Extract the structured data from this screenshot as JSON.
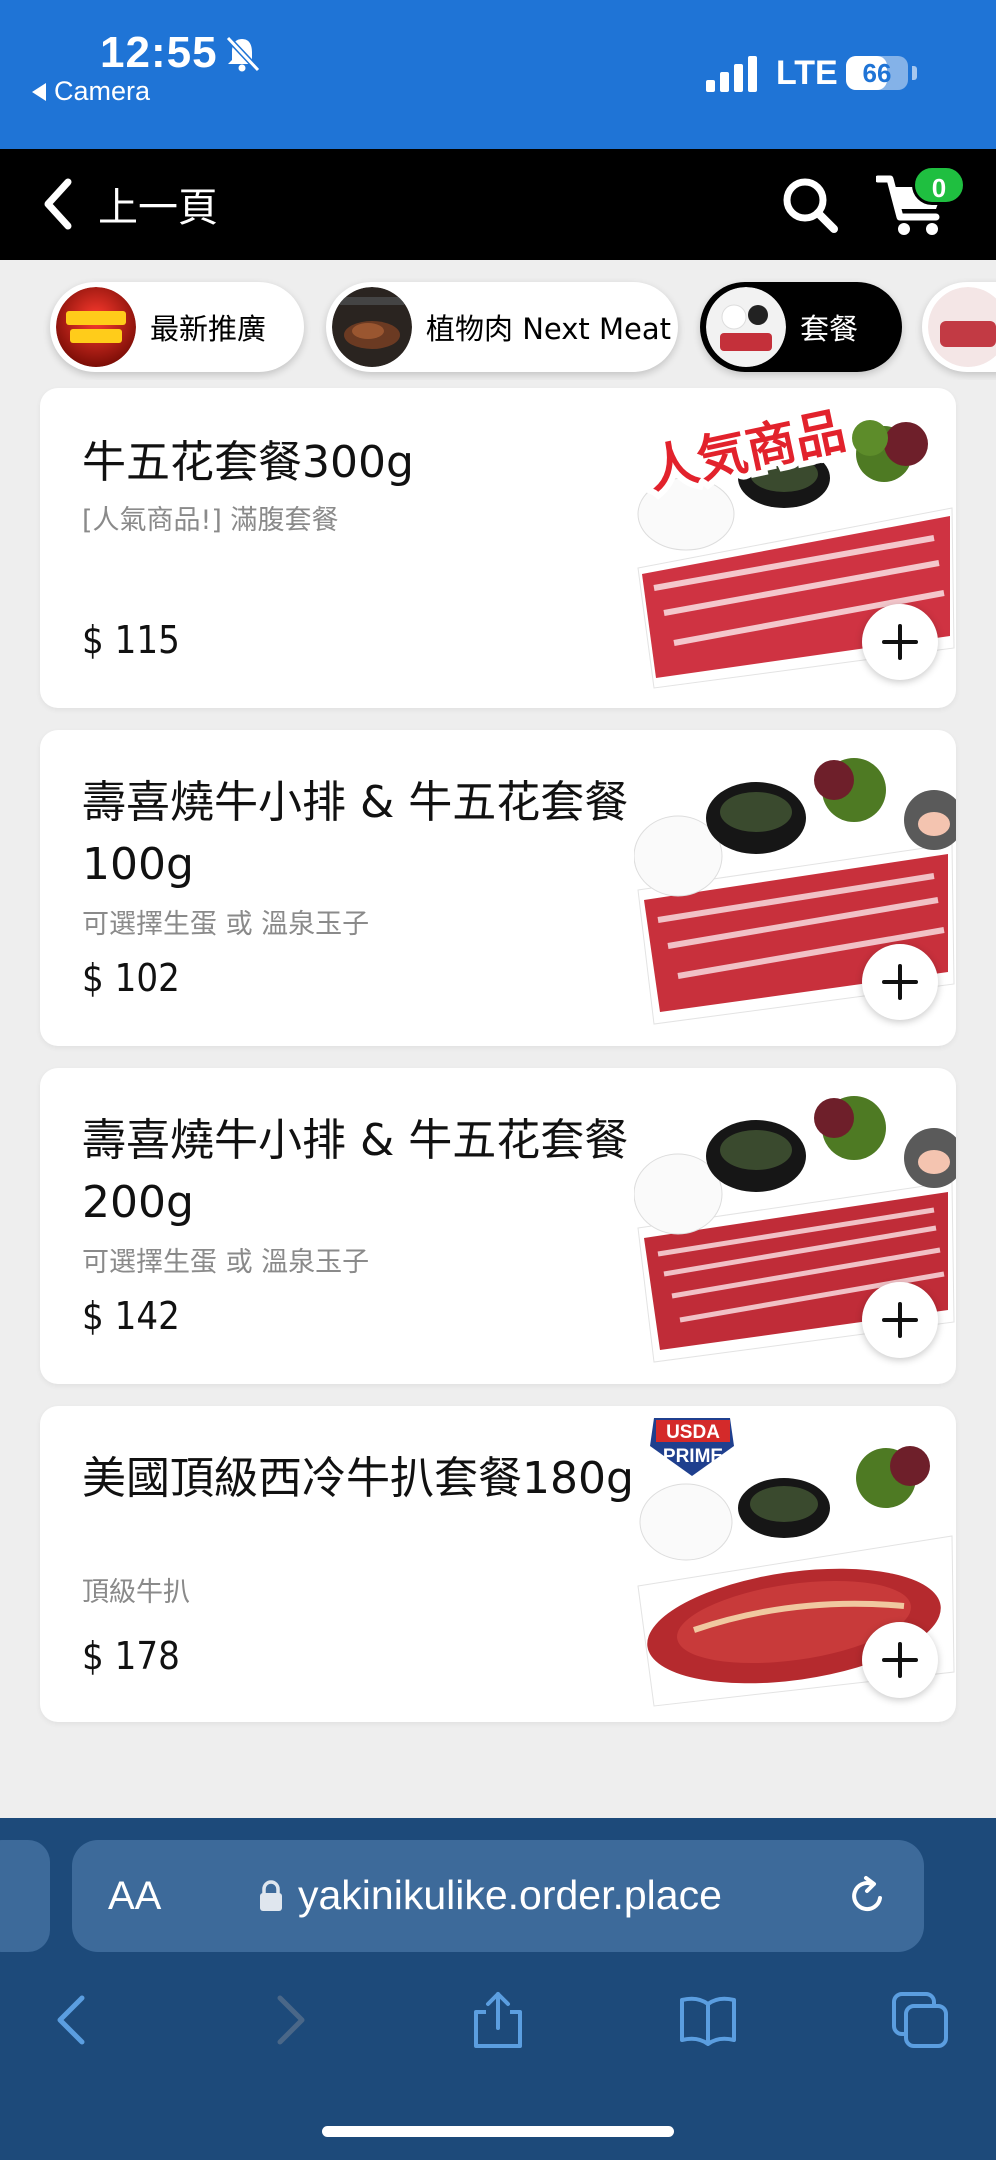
{
  "status_bar": {
    "time": "12:55",
    "back_app": "Camera",
    "network": "LTE",
    "battery": "66",
    "battery_level": 0.66
  },
  "header": {
    "back_label": "上一頁",
    "cart_count": "0"
  },
  "categories": [
    {
      "label": "最新推廣",
      "active": false
    },
    {
      "label": "植物肉 Next Meat",
      "active": false
    },
    {
      "label": "套餐",
      "active": true
    }
  ],
  "products": [
    {
      "title": "牛五花套餐300g",
      "desc": "[人氣商品!] 滿腹套餐",
      "price": "$ 115"
    },
    {
      "title": "壽喜燒牛小排 & 牛五花套餐100g",
      "desc": "可選擇生蛋 或 溫泉玉子",
      "price": "$ 102"
    },
    {
      "title": "壽喜燒牛小排 & 牛五花套餐200g",
      "desc": "可選擇生蛋 或 溫泉玉子",
      "price": "$ 142"
    },
    {
      "title": "美國頂級西冷牛扒套餐180g",
      "desc": "頂級牛扒",
      "price": "$ 178"
    }
  ],
  "product_image_text": {
    "popular_banner": "人気商品",
    "usda_line1": "USDA",
    "usda_line2": "PRIME"
  },
  "browser": {
    "text_size_label": "AA",
    "url": "yakinikulike.order.place"
  },
  "colors": {
    "status_blue": "#1f74d6",
    "header_black": "#000000",
    "badge_green": "#1fbf40",
    "browser_bar": "#1d4a7a"
  }
}
